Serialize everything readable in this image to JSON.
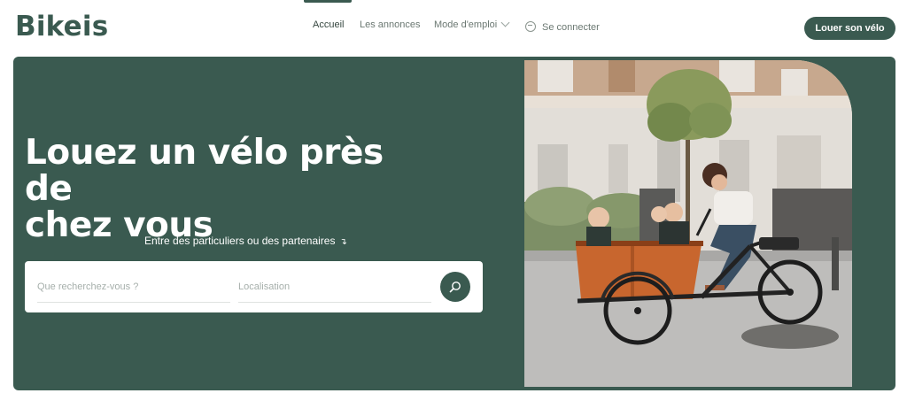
{
  "brand": {
    "logo": "Bikeis"
  },
  "nav": {
    "items": [
      {
        "label": "Accueil"
      },
      {
        "label": "Les annonces"
      },
      {
        "label": "Mode d'emploi"
      },
      {
        "label": "Se connecter"
      }
    ],
    "cta_label": "Louer son vélo"
  },
  "hero": {
    "title_line1": "Louez un vélo près de",
    "title_line2": "chez vous",
    "subtitle": "Entre des particuliers ou des partenaires",
    "search": {
      "query_placeholder": "Que recherchez-vous ?",
      "location_placeholder": "Localisation"
    }
  },
  "colors": {
    "brand": "#3a5a50",
    "hero_bg": "#3a5a50",
    "cargo": "#c8662e"
  },
  "icons": {
    "dropdown": "chevron-down-icon",
    "login": "login-icon",
    "subtitle_arrow": "arrow-down-right-icon",
    "search": "search-icon"
  }
}
